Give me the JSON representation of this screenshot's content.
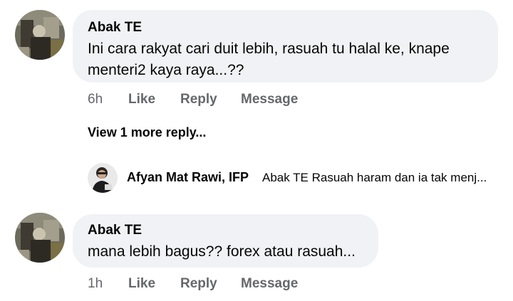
{
  "comments": [
    {
      "author": "Abak TE",
      "text_lines": [
        "Ini cara rakyat cari duit lebih, rasuah tu halal ke, knape",
        "menteri2 kaya raya...??"
      ],
      "time": "6h",
      "like_label": "Like",
      "reply_label": "Reply",
      "message_label": "Message"
    },
    {
      "author": "Abak TE",
      "text_lines": [
        "mana lebih bagus?? forex atau rasuah..."
      ],
      "time": "1h",
      "like_label": "Like",
      "reply_label": "Reply",
      "message_label": "Message"
    }
  ],
  "view_more_replies": "View 1 more reply...",
  "reply_preview": {
    "author": "Afyan Mat Rawi, IFP",
    "snippet": "Abak TE Rasuah haram dan ia tak menj..."
  },
  "colors": {
    "bubble_bg": "#f0f2f5",
    "meta_text": "#65676b",
    "primary_text": "#050505"
  },
  "icons": {
    "commenter_avatar": "profile-photo",
    "reply_avatar": "profile-photo"
  }
}
